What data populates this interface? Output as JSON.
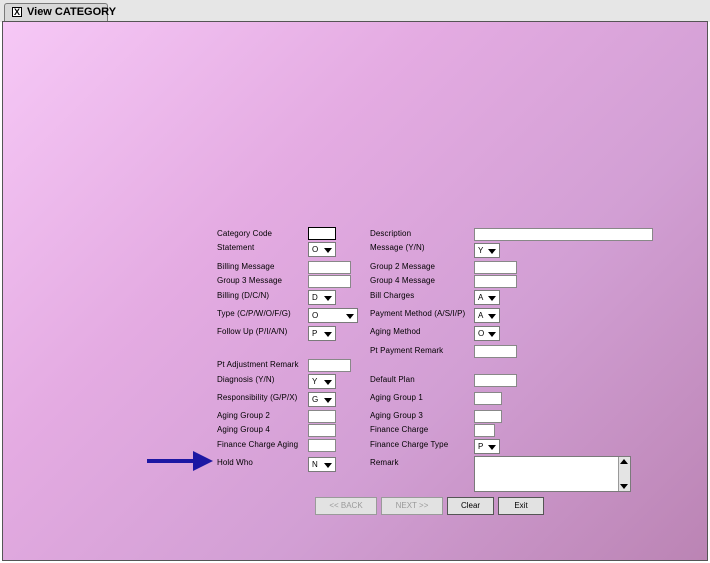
{
  "window": {
    "title": "View CATEGORY",
    "close_glyph": "X"
  },
  "labels": {
    "category_code": "Category Code",
    "description": "Description",
    "statement": "Statement",
    "message_yn": "Message (Y/N)",
    "billing_message": "Billing Message",
    "group2_message": "Group 2  Message",
    "group3_message": "Group 3  Message",
    "group4_message": "Group 4  Message",
    "billing_dcn": "Billing (D/C/N)",
    "bill_charges": "Bill Charges",
    "type": "Type (C/P/W/O/F/G)",
    "payment_method": "Payment Method (A/S/I/P)",
    "follow_up": "Follow Up (P/I/A/N)",
    "aging_method": "Aging Method",
    "pt_payment_remark": "Pt Payment Remark",
    "pt_adjustment_remark": "Pt Adjustment Remark",
    "diagnosis": "Diagnosis (Y/N)",
    "default_plan": "Default Plan",
    "responsibility": "Responsibility (G/P/X)",
    "aging_group_1": "Aging Group 1",
    "aging_group_2": "Aging Group 2",
    "aging_group_3": "Aging Group 3",
    "aging_group_4": "Aging Group 4",
    "finance_charge": "Finance Charge",
    "finance_charge_aging": "Finance Charge Aging",
    "finance_charge_type": "Finance Charge Type",
    "hold_who": "Hold Who",
    "remark": "Remark"
  },
  "values": {
    "statement": "O",
    "message_yn": "Y",
    "billing_dcn": "D",
    "bill_charges": "A",
    "type": "O",
    "payment_method": "A",
    "follow_up": "P",
    "aging_method": "O",
    "diagnosis": "Y",
    "responsibility": "G",
    "finance_charge_type": "P",
    "hold_who": "N"
  },
  "buttons": {
    "back": "<< BACK",
    "next": "NEXT >>",
    "clear": "Clear",
    "exit": "Exit"
  },
  "colors": {
    "annotation_arrow": "#1c17a3"
  }
}
